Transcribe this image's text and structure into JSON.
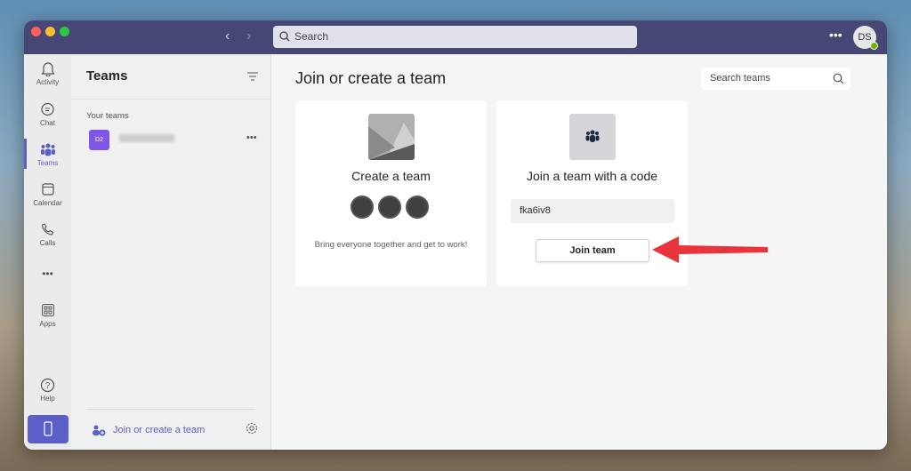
{
  "titlebar": {
    "search_placeholder": "Search",
    "avatar_initials": "DS"
  },
  "rail": [
    {
      "label": "Activity"
    },
    {
      "label": "Chat"
    },
    {
      "label": "Teams"
    },
    {
      "label": "Calendar"
    },
    {
      "label": "Calls"
    },
    {
      "label": "Apps"
    },
    {
      "label": "Help"
    }
  ],
  "sidebar": {
    "title": "Teams",
    "section": "Your teams",
    "team_initials": "D2",
    "join_create": "Join or create a team"
  },
  "main": {
    "title": "Join or create a team",
    "search_teams": "Search teams",
    "create_card": {
      "title": "Create a team",
      "description": "Bring everyone together and get to work!"
    },
    "join_card": {
      "title": "Join a team with a code",
      "code_value": "fka6iv8",
      "button": "Join team"
    }
  },
  "colors": {
    "brand": "#464775",
    "accent": "#5b5fc7",
    "arrow": "#e8343a"
  }
}
